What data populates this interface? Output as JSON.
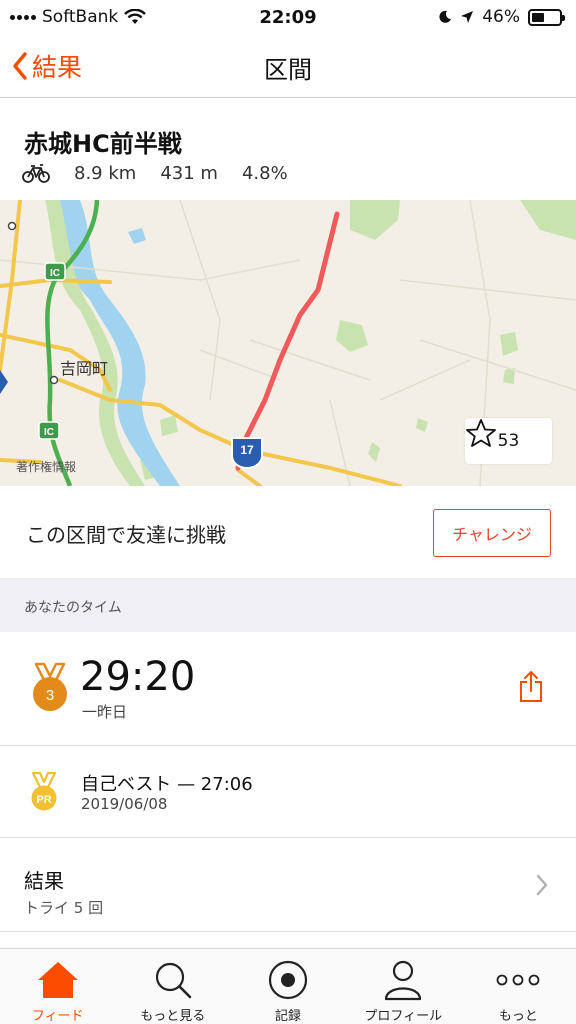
{
  "status_bar": {
    "carrier": "SoftBank",
    "time": "22:09",
    "battery": "46%",
    "battery_level": 0.46
  },
  "nav": {
    "back_label": "結果",
    "title": "区間"
  },
  "segment": {
    "name": "赤城HC前半戦",
    "distance": "8.9 km",
    "elevation": "431 m",
    "grade": "4.8%"
  },
  "map": {
    "labels": {
      "town": "吉岡町",
      "ic_1": "IC",
      "ic_2": "IC",
      "route": "17"
    },
    "credit": "著作権情報",
    "star_count": "53",
    "colors": {
      "route_line": "#f05a5a",
      "expressway": "#4caf50",
      "major_road": "#f3c64c",
      "river": "#9fd3f0"
    }
  },
  "challenge": {
    "text": "この区間で友達に挑戦",
    "button": "チャレンジ"
  },
  "your_time": {
    "section_title": "あなたのタイム",
    "rank": "3",
    "time": "29:20",
    "when": "一昨日"
  },
  "personal_best": {
    "badge": "PR",
    "label": "自己ベスト — 27:06",
    "date": "2019/06/08"
  },
  "results": {
    "title": "結果",
    "subtitle": "トライ 5 回"
  },
  "tabs": [
    {
      "label": "フィード",
      "icon": "home-icon",
      "active": true
    },
    {
      "label": "もっと見る",
      "icon": "search-icon",
      "active": false
    },
    {
      "label": "記録",
      "icon": "record-icon",
      "active": false
    },
    {
      "label": "プロフィール",
      "icon": "profile-icon",
      "active": false
    },
    {
      "label": "もっと",
      "icon": "more-icon",
      "active": false
    }
  ],
  "accent_color": "#fc4c02"
}
